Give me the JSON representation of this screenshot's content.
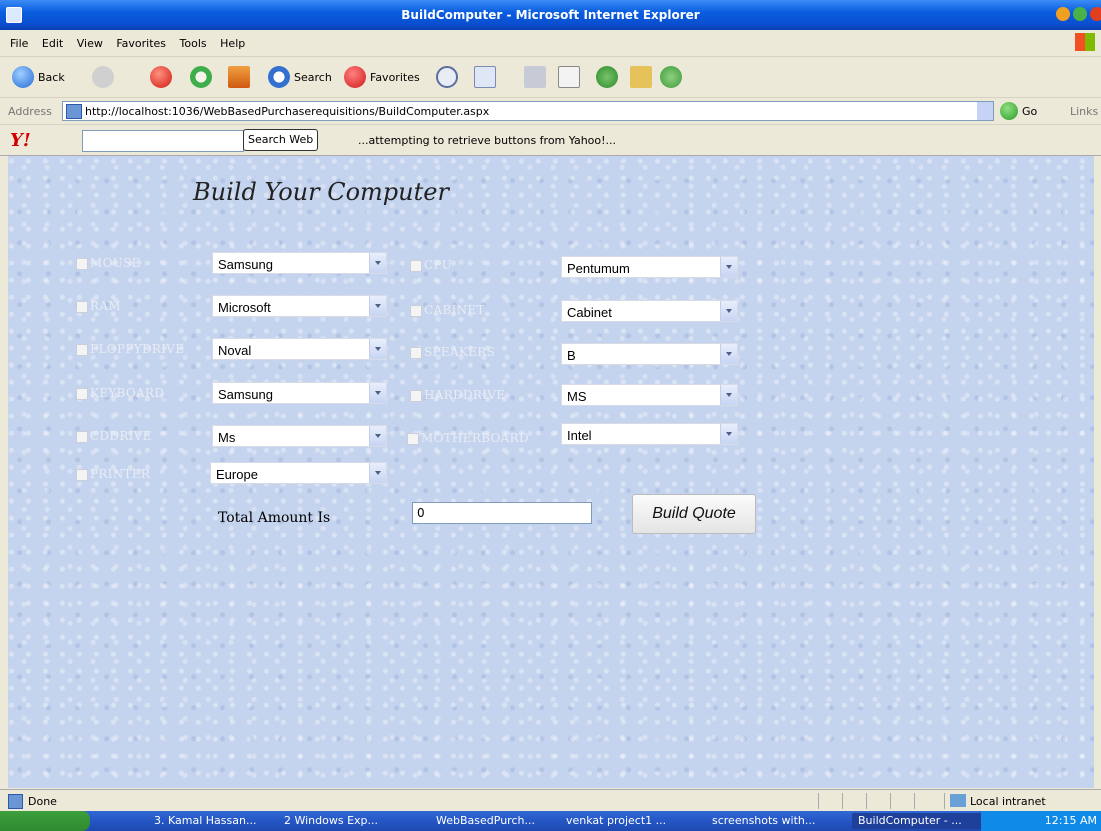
{
  "window": {
    "title": "BuildComputer - Microsoft Internet Explorer"
  },
  "menu": [
    "File",
    "Edit",
    "View",
    "Favorites",
    "Tools",
    "Help"
  ],
  "toolbar": {
    "back_label": "Back",
    "search_label": "Search",
    "favorites_label": "Favorites"
  },
  "address": {
    "label": "Address",
    "url": "http://localhost:1036/WebBasedPurchaserequisitions/BuildComputer.aspx",
    "go_label": "Go",
    "links_label": "Links"
  },
  "yahoo": {
    "logo": "Y!",
    "search_placeholder": "",
    "search_button": "Search Web",
    "message": "...attempting to retrieve buttons from Yahoo!..."
  },
  "page": {
    "title": "Build Your Computer",
    "left": [
      {
        "label": "MOUSE",
        "value": "Samsung"
      },
      {
        "label": "RAM",
        "value": "Microsoft"
      },
      {
        "label": "FLOPPYDRIVE",
        "value": "Noval"
      },
      {
        "label": "KEYBOARD",
        "value": "Samsung"
      },
      {
        "label": "CDDRIVE",
        "value": "Ms"
      },
      {
        "label": "PRINTER",
        "value": "Europe"
      }
    ],
    "right": [
      {
        "label": "CPU",
        "value": "Pentumum"
      },
      {
        "label": "CABINET",
        "value": "Cabinet"
      },
      {
        "label": "SPEAKERS",
        "value": "B"
      },
      {
        "label": "HARDDRIVE",
        "value": "MS"
      },
      {
        "label": "MOTHERBOARD",
        "value": "Intel"
      }
    ],
    "total_label": "Total Amount Is",
    "total_value": "0",
    "build_button": "Build Quote"
  },
  "status": {
    "text": "Done",
    "zone": "Local intranet"
  },
  "taskbar": {
    "items": [
      "3. Kamal Hassan...",
      "2 Windows Exp...",
      "WebBasedPurch...",
      "venkat project1 ...",
      "screenshots with...",
      "BuildComputer - ..."
    ],
    "clock": "12:15 AM"
  }
}
